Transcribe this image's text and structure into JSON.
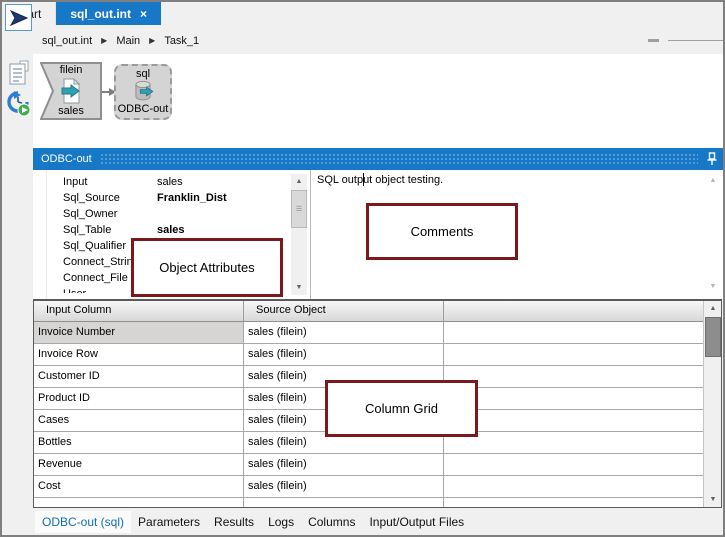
{
  "window": {
    "tabs": [
      {
        "label": "Start",
        "active": false
      },
      {
        "label": "sql_out.int",
        "active": true
      }
    ],
    "breadcrumb": {
      "items": [
        "sql_out.int",
        "Main",
        "Task_1"
      ]
    }
  },
  "icons": {
    "close": "×",
    "breadcrumb_separator": "▶",
    "scroll_up": "▲",
    "scroll_down": "▼",
    "thumb_grip": "☰"
  },
  "sidebar": {
    "items": [
      "flow-design",
      "report",
      "run-history"
    ]
  },
  "canvas": {
    "nodes": [
      {
        "type_label": "filein",
        "name_label": "sales",
        "selected": false
      },
      {
        "type_label": "sql",
        "name_label": "ODBC-out",
        "selected": true
      }
    ]
  },
  "panel": {
    "title": "ODBC-out",
    "attributes": {
      "rows": [
        {
          "label": "Input",
          "value": "sales",
          "bold": false
        },
        {
          "label": "Sql_Source",
          "value": "Franklin_Dist",
          "bold": true
        },
        {
          "label": "Sql_Owner",
          "value": "",
          "bold": false
        },
        {
          "label": "Sql_Table",
          "value": "sales",
          "bold": true
        },
        {
          "label": "Sql_Qualifier",
          "value": "",
          "bold": false
        },
        {
          "label": "Connect_String",
          "value": "",
          "bold": false
        },
        {
          "label": "Connect_File",
          "value": "",
          "bold": false
        },
        {
          "label": "User",
          "value": "",
          "bold": false
        }
      ]
    },
    "comments": {
      "text": "SQL output object testing."
    }
  },
  "grid": {
    "columns": [
      "Input Column",
      "Source Object",
      ""
    ],
    "rows": [
      {
        "input_column": "Invoice Number",
        "source_object": "sales (filein)",
        "selected": true
      },
      {
        "input_column": "Invoice Row",
        "source_object": "sales (filein)",
        "selected": false
      },
      {
        "input_column": "Customer ID",
        "source_object": "sales (filein)",
        "selected": false
      },
      {
        "input_column": "Product ID",
        "source_object": "sales (filein)",
        "selected": false
      },
      {
        "input_column": "Cases",
        "source_object": "sales (filein)",
        "selected": false
      },
      {
        "input_column": "Bottles",
        "source_object": "sales (filein)",
        "selected": false
      },
      {
        "input_column": "Revenue",
        "source_object": "sales (filein)",
        "selected": false
      },
      {
        "input_column": "Cost",
        "source_object": "sales (filein)",
        "selected": false
      }
    ]
  },
  "bottom_tabs": [
    {
      "label": "ODBC-out (sql)",
      "active": true
    },
    {
      "label": "Parameters",
      "active": false
    },
    {
      "label": "Results",
      "active": false
    },
    {
      "label": "Logs",
      "active": false
    },
    {
      "label": "Columns",
      "active": false
    },
    {
      "label": "Input/Output Files",
      "active": false
    }
  ],
  "annotations": {
    "object_attributes": {
      "label": "Object Attributes"
    },
    "comments": {
      "label": "Comments"
    },
    "column_grid": {
      "label": "Column Grid"
    }
  },
  "colors": {
    "accent_blue": "#1878c8",
    "annotation_red": "#7b191c",
    "teal_arrow": "#2fa0b0",
    "node_gray": "#d4d4d4"
  }
}
